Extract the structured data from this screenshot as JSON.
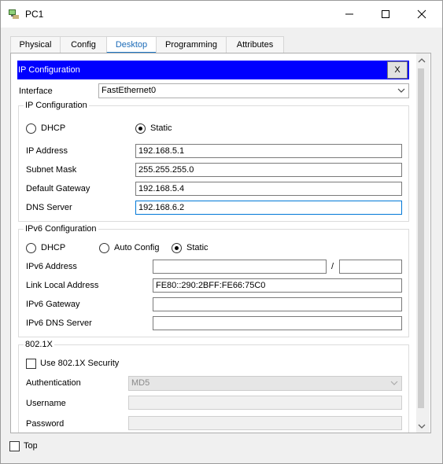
{
  "window": {
    "title": "PC1"
  },
  "tabs": [
    {
      "label": "Physical"
    },
    {
      "label": "Config"
    },
    {
      "label": "Desktop"
    },
    {
      "label": "Programming"
    },
    {
      "label": "Attributes"
    }
  ],
  "active_tab": "Desktop",
  "ip_config_bar": {
    "title": "IP Configuration",
    "close_label": "X"
  },
  "interface": {
    "label": "Interface",
    "value": "FastEthernet0"
  },
  "ipv4": {
    "group_title": "IP Configuration",
    "dhcp_label": "DHCP",
    "static_label": "Static",
    "mode": "Static",
    "ip_address_label": "IP Address",
    "ip_address": "192.168.5.1",
    "subnet_mask_label": "Subnet Mask",
    "subnet_mask": "255.255.255.0",
    "gateway_label": "Default Gateway",
    "gateway": "192.168.5.4",
    "dns_label": "DNS Server",
    "dns": "192.168.6.2"
  },
  "ipv6": {
    "group_title": "IPv6 Configuration",
    "dhcp_label": "DHCP",
    "auto_label": "Auto Config",
    "static_label": "Static",
    "mode": "Static",
    "address_label": "IPv6 Address",
    "address": "",
    "prefix_separator": "/",
    "prefix": "",
    "link_local_label": "Link Local Address",
    "link_local": "FE80::290:2BFF:FE66:75C0",
    "gateway_label": "IPv6 Gateway",
    "gateway": "",
    "dns_label": "IPv6 DNS Server",
    "dns": ""
  },
  "dot1x": {
    "group_title": "802.1X",
    "use_label": "Use 802.1X Security",
    "use_checked": false,
    "auth_label": "Authentication",
    "auth_value": "MD5",
    "username_label": "Username",
    "username": "",
    "password_label": "Password",
    "password": ""
  },
  "footer": {
    "top_label": "Top",
    "top_checked": false
  },
  "colors": {
    "ip_bar": "#0000ff",
    "tab_active": "#1f79c7"
  }
}
